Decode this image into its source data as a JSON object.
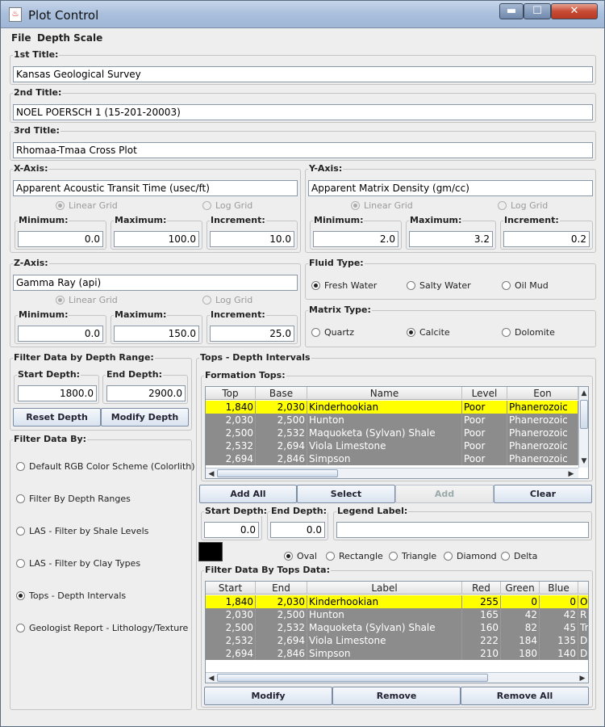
{
  "window": {
    "title": "Plot Control",
    "app_icon": "java-cup-icon"
  },
  "menu": {
    "file": "File",
    "depth_scale": "Depth Scale"
  },
  "titles": {
    "first_label": "1st Title:",
    "first_value": "Kansas Geological Survey",
    "second_label": "2nd Title:",
    "second_value": "NOEL POERSCH 1 (15-201-20003)",
    "third_label": "3rd Title:",
    "third_value": "Rhomaa-Tmaa Cross Plot"
  },
  "x_axis": {
    "label": "X-Axis:",
    "name": "Apparent Acoustic Transit Time (usec/ft)",
    "linear": "Linear Grid",
    "log": "Log Grid",
    "min_label": "Minimum:",
    "min": "0.0",
    "max_label": "Maximum:",
    "max": "100.0",
    "inc_label": "Increment:",
    "inc": "10.0"
  },
  "y_axis": {
    "label": "Y-Axis:",
    "name": "Apparent Matrix Density (gm/cc)",
    "linear": "Linear Grid",
    "log": "Log Grid",
    "min_label": "Minimum:",
    "min": "2.0",
    "max_label": "Maximum:",
    "max": "3.2",
    "inc_label": "Increment:",
    "inc": "0.2"
  },
  "z_axis": {
    "label": "Z-Axis:",
    "name": "Gamma Ray (api)",
    "linear": "Linear Grid",
    "log": "Log Grid",
    "min_label": "Minimum:",
    "min": "0.0",
    "max_label": "Maximum:",
    "max": "150.0",
    "inc_label": "Increment:",
    "inc": "25.0"
  },
  "fluid": {
    "label": "Fluid Type:",
    "options": [
      "Fresh Water",
      "Salty Water",
      "Oil Mud"
    ],
    "selected": "Fresh Water"
  },
  "matrix": {
    "label": "Matrix Type:",
    "options": [
      "Quartz",
      "Calcite",
      "Dolomite"
    ],
    "selected": "Calcite"
  },
  "depth_filter": {
    "label": "Filter Data by Depth Range:",
    "start_label": "Start Depth:",
    "start": "1800.0",
    "end_label": "End Depth:",
    "end": "2900.0",
    "reset": "Reset Depth",
    "modify": "Modify Depth"
  },
  "filter_by": {
    "label": "Filter Data By:",
    "options": [
      "Default RGB Color Scheme (Colorlith)",
      "Filter By Depth Ranges",
      "LAS - Filter by Shale Levels",
      "LAS - Filter by Clay Types",
      "Tops - Depth Intervals",
      "Geologist Report - Lithology/Texture"
    ],
    "selected": "Tops - Depth Intervals"
  },
  "tops": {
    "label": "Tops - Depth Intervals",
    "formation_label": "Formation Tops:",
    "columns": [
      "Top",
      "Base",
      "Name",
      "Level",
      "Eon"
    ],
    "rows": [
      [
        "1,840",
        "2,030",
        "Kinderhookian",
        "Poor",
        "Phanerozoic"
      ],
      [
        "2,030",
        "2,500",
        "Hunton",
        "Poor",
        "Phanerozoic"
      ],
      [
        "2,500",
        "2,532",
        "Maquoketa (Sylvan) Shale",
        "Poor",
        "Phanerozoic"
      ],
      [
        "2,532",
        "2,694",
        "Viola Limestone",
        "Poor",
        "Phanerozoic"
      ],
      [
        "2,694",
        "2,846",
        "Simpson",
        "Poor",
        "Phanerozoic"
      ]
    ],
    "add_all": "Add All",
    "select": "Select",
    "add": "Add",
    "clear": "Clear",
    "start_label": "Start Depth:",
    "start": "0.0",
    "end_label": "End Depth:",
    "end": "0.0",
    "legend_label": "Legend Label:",
    "legend": "",
    "swatch_color": "#000000",
    "symbols": [
      "Oval",
      "Rectangle",
      "Triangle",
      "Diamond",
      "Delta"
    ],
    "symbol_selected": "Oval"
  },
  "tops_data": {
    "label": "Filter Data By Tops Data:",
    "columns": [
      "Start",
      "End",
      "Label",
      "Red",
      "Green",
      "Blue",
      ""
    ],
    "rows": [
      [
        "1,840",
        "2,030",
        "Kinderhookian",
        "255",
        "0",
        "0",
        "O"
      ],
      [
        "2,030",
        "2,500",
        "Hunton",
        "165",
        "42",
        "42",
        "R"
      ],
      [
        "2,500",
        "2,532",
        "Maquoketa (Sylvan) Shale",
        "160",
        "82",
        "45",
        "Tr"
      ],
      [
        "2,532",
        "2,694",
        "Viola Limestone",
        "222",
        "184",
        "135",
        "D"
      ],
      [
        "2,694",
        "2,846",
        "Simpson",
        "210",
        "180",
        "140",
        "D"
      ]
    ],
    "modify": "Modify",
    "remove": "Remove",
    "remove_all": "Remove All"
  },
  "colors": {
    "selected_row": "#ffff00",
    "other_rows": "#8c8c8c"
  }
}
